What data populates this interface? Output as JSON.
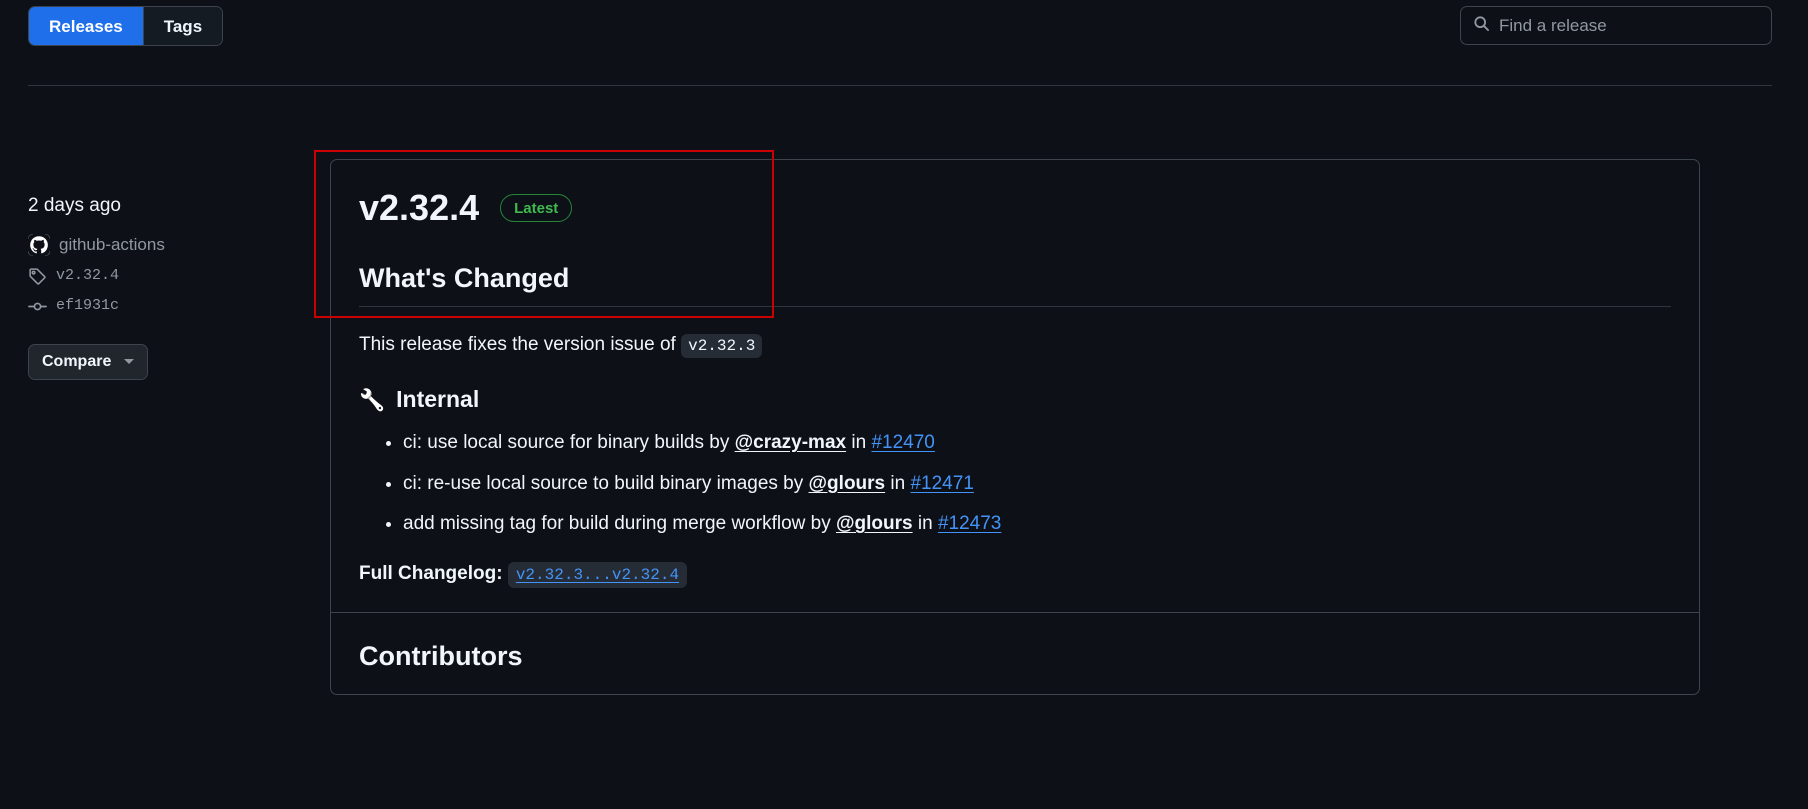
{
  "header": {
    "tabs": [
      {
        "label": "Releases",
        "selected": true
      },
      {
        "label": "Tags",
        "selected": false
      }
    ],
    "search": {
      "placeholder": "Find a release",
      "value": "",
      "icon": "search-icon"
    }
  },
  "sidebar": {
    "date": "2 days ago",
    "author": {
      "name": "github-actions",
      "avatar_icon": "github-mark-icon"
    },
    "tag": {
      "label": "v2.32.4",
      "icon": "tag-icon"
    },
    "commit": {
      "label": "ef1931c",
      "icon": "commit-icon"
    },
    "compare_button": {
      "label": "Compare",
      "icon": "chevron-down-icon"
    }
  },
  "release": {
    "title": "v2.32.4",
    "badge": "Latest",
    "whats_changed_heading": "What's Changed",
    "intro_prefix": "This release fixes the version issue of ",
    "intro_code": "v2.32.3",
    "internal_heading": "Internal",
    "internal_emoji": "🔧",
    "changes": [
      {
        "text_before": "ci: use local source for binary builds by ",
        "mention": "@crazy-max",
        "text_middle": " in ",
        "pr": "#12470"
      },
      {
        "text_before": "ci: re-use local source to build binary images by ",
        "mention": "@glours",
        "text_middle": " in ",
        "pr": "#12471"
      },
      {
        "text_before": "add missing tag for build during merge workflow by ",
        "mention": "@glours",
        "text_middle": " in ",
        "pr": "#12473"
      }
    ],
    "changelog_label": "Full Changelog:",
    "changelog_link": "v2.32.3...v2.32.4",
    "contributors_heading": "Contributors"
  },
  "annotation": {
    "color": "#cc0000",
    "target": "release-title-region"
  }
}
